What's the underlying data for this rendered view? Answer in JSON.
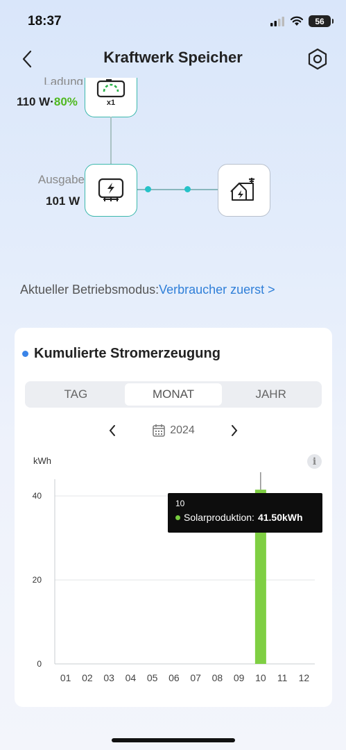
{
  "status_bar": {
    "time": "18:37",
    "battery": "56"
  },
  "header": {
    "title": "Kraftwerk Speicher"
  },
  "flow": {
    "charge": {
      "label": "Ladung",
      "value": "110 W",
      "separator": "·",
      "percent": "80%",
      "count": "x1"
    },
    "output": {
      "label": "Ausgabe",
      "value": "101 W"
    }
  },
  "mode": {
    "label": "Aktueller Betriebsmodus:",
    "value": "Verbraucher zuerst >"
  },
  "card": {
    "title": "Kumulierte Stromerzeugung",
    "tabs": [
      {
        "label": "TAG",
        "active": false
      },
      {
        "label": "MONAT",
        "active": true
      },
      {
        "label": "JAHR",
        "active": false
      }
    ],
    "year": "2024",
    "unit": "kWh",
    "info": "i"
  },
  "tooltip": {
    "category": "10",
    "series": "Solarproduktion:",
    "value": "41.50kWh"
  },
  "colors": {
    "accent": "#2f7fd8",
    "bar": "#7fcf43",
    "node_border": "#3bb8ac",
    "percent": "#4fb81f"
  },
  "chart_data": {
    "type": "bar",
    "categories": [
      "01",
      "02",
      "03",
      "04",
      "05",
      "06",
      "07",
      "08",
      "09",
      "10",
      "11",
      "12"
    ],
    "series": [
      {
        "name": "Solarproduktion",
        "values": [
          0,
          0,
          0,
          0,
          0,
          0,
          0,
          0,
          0,
          41.5,
          0,
          0
        ]
      }
    ],
    "ylabel": "kWh",
    "ylim": [
      0,
      44
    ],
    "yticks": [
      0,
      20,
      40
    ],
    "grid": true,
    "highlight_index": 9
  }
}
